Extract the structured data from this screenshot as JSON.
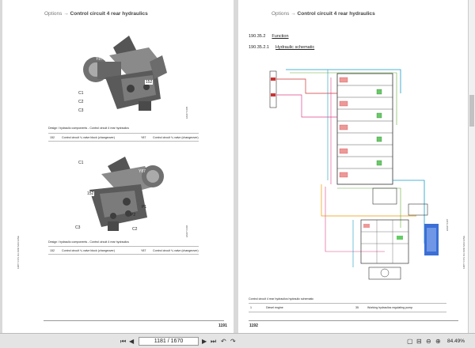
{
  "left_page": {
    "header_prefix": "Options",
    "header_arrow": "→",
    "header_title": "Control circuit 4 rear hydraulics",
    "figure1": {
      "callouts": [
        "Y87",
        "152",
        "C1",
        "C2",
        "C3"
      ],
      "code": "EM47 0405",
      "caption": "Design / hydraulic components - Control circuit 4 rear hydraulics",
      "rows": [
        {
          "num": "152",
          "text": "Control circuit ¼ valve block (changeover)",
          "num2": "Y87",
          "text2": "Control circuit ¼ valve (changeover)"
        }
      ]
    },
    "figure2": {
      "callouts": [
        "C1",
        "Y87",
        "152",
        "P1",
        "P2",
        "C3",
        "C2"
      ],
      "code": "EM47 0406",
      "caption": "Design / hydraulic components - Control circuit 4 rear hydraulics",
      "rows": [
        {
          "num": "152",
          "text": "Control circuit ¼ valve block (changeover)",
          "num2": "Y87",
          "text2": "Control circuit ¼ valve (changeover)"
        }
      ]
    },
    "side_code": "1MP7 CCS DA 4960 MACHINE",
    "page_number": "1191"
  },
  "right_page": {
    "header_prefix": "Options",
    "header_arrow": "→",
    "header_title": "Control circuit 4 rear hydraulics",
    "section1_num": "190.35.2",
    "section1_label": "Function",
    "section2_num": "190.35.2.1",
    "section2_label": "Hydraulic schematic",
    "schematic_code": "EM47 0407",
    "caption": "Control circuit 4 rear hydraulics hydraulic schematic",
    "row": {
      "num": "1",
      "text": "Diesel engine",
      "num2": "35",
      "text2": "Working hydraulics regulating pump"
    },
    "side_code": "1MP7 CCS DA 4960 MACHINE",
    "page_number": "1192"
  },
  "toolbar": {
    "first_icon": "first-page-icon",
    "prev_icon": "prev-page-icon",
    "page_indicator": "1181 / 1670",
    "next_icon": "next-page-icon",
    "last_icon": "last-page-icon",
    "back_icon": "back-icon",
    "forward_icon": "forward-icon",
    "zoom": "84.49%"
  }
}
